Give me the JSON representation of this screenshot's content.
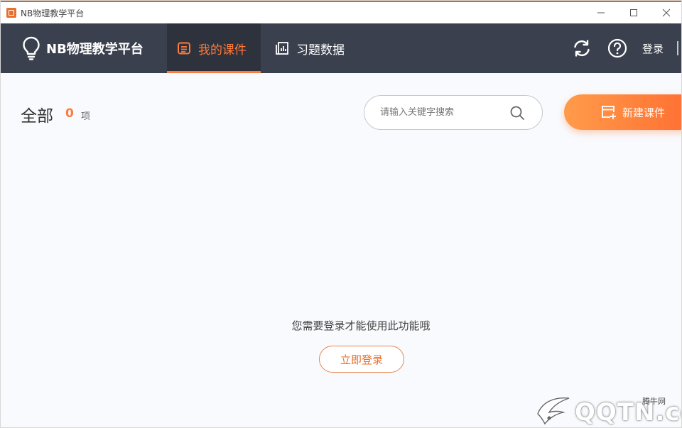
{
  "window": {
    "title": "NB物理教学平台"
  },
  "nav": {
    "brand": "NB物理教学平台",
    "tabs": [
      {
        "label": "我的课件",
        "icon": "courseware-icon",
        "active": true
      },
      {
        "label": "习题数据",
        "icon": "data-icon",
        "active": false
      }
    ],
    "refresh_icon": "refresh-icon",
    "help_icon": "help-icon",
    "login_label": "登录"
  },
  "content": {
    "title": "全部",
    "count": "0",
    "count_unit": "项",
    "search_placeholder": "请输入关键字搜索",
    "new_button_label": "新建课件",
    "empty_message": "您需要登录才能使用此功能哦",
    "login_button_label": "立即登录"
  },
  "watermark": {
    "text": "QQTN.com",
    "small_text": "腾牛网"
  },
  "colors": {
    "accent": "#ff7a3c",
    "nav_bg": "#3a404d",
    "nav_active_bg": "#2d323c",
    "content_bg": "#f9fafd"
  }
}
